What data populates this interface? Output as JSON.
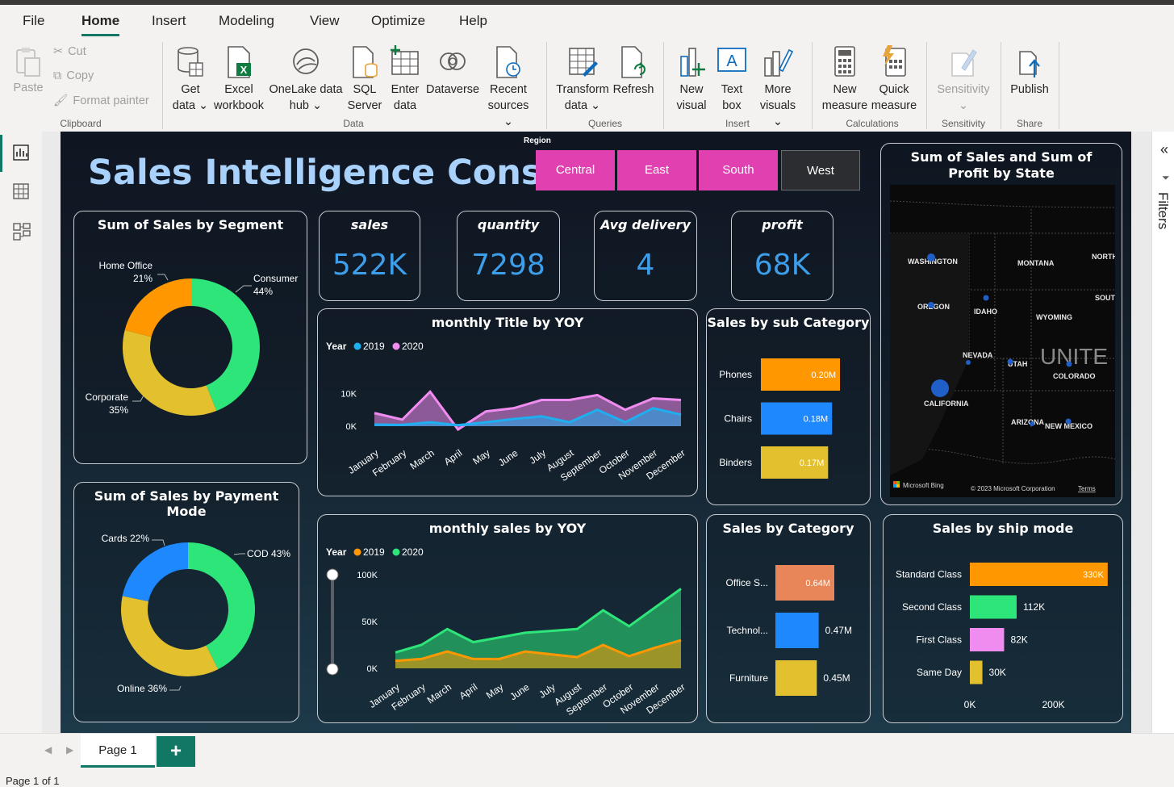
{
  "menu": {
    "file": "File",
    "home": "Home",
    "insert": "Insert",
    "modeling": "Modeling",
    "view": "View",
    "optimize": "Optimize",
    "help": "Help"
  },
  "ribbon": {
    "clipboard": {
      "paste": "Paste",
      "cut": "Cut",
      "copy": "Copy",
      "format_painter": "Format painter",
      "group": "Clipboard"
    },
    "data": {
      "get_data_1": "Get",
      "get_data_2": "data",
      "excel_1": "Excel",
      "excel_2": "workbook",
      "onelake_1": "OneLake data",
      "onelake_2": "hub",
      "sql_1": "SQL",
      "sql_2": "Server",
      "enter_1": "Enter",
      "enter_2": "data",
      "dataverse": "Dataverse",
      "recent_1": "Recent",
      "recent_2": "sources",
      "group": "Data"
    },
    "queries": {
      "transform_1": "Transform",
      "transform_2": "data",
      "refresh": "Refresh",
      "group": "Queries"
    },
    "insert": {
      "new_visual_1": "New",
      "new_visual_2": "visual",
      "text_box_1": "Text",
      "text_box_2": "box",
      "more_visuals_1": "More",
      "more_visuals_2": "visuals",
      "group": "Insert"
    },
    "calculations": {
      "new_measure_1": "New",
      "new_measure_2": "measure",
      "quick_measure_1": "Quick",
      "quick_measure_2": "measure",
      "group": "Calculations"
    },
    "sensitivity": {
      "label": "Sensitivity",
      "group": "Sensitivity"
    },
    "share": {
      "publish": "Publish",
      "group": "Share"
    }
  },
  "right_pane": {
    "filters": "Filters"
  },
  "report": {
    "title": "Sales Intelligence Console",
    "slicer": {
      "label": "Region",
      "items": [
        "Central",
        "East",
        "South",
        "West"
      ]
    },
    "kpis": [
      {
        "title": "sales",
        "value": "522K"
      },
      {
        "title": "quantity",
        "value": "7298"
      },
      {
        "title": "Avg delivery",
        "value": "4"
      },
      {
        "title": "profit",
        "value": "68K"
      }
    ],
    "segment_title": "Sum of Sales by Segment",
    "payment_title": "Sum of Sales by Payment Mode",
    "monthly_title_title": "monthly Title by YOY",
    "monthly_sales_title": "monthly sales by YOY",
    "subcat_title": "Sales by sub Category",
    "category_title": "Sales by Category",
    "map_title": "Sum of Sales and Sum of Profit by State",
    "ship_title": "Sales by ship mode",
    "map": {
      "states": [
        "WASHINGTON",
        "MONTANA",
        "NORTH",
        "OREGON",
        "IDAHO",
        "SOUTH",
        "WYOMING",
        "NEVADA",
        "UTAH",
        "UNITE",
        "COLORADO",
        "CALIFORNIA",
        "ARIZONA",
        "NEW MEXICO"
      ],
      "bing": "Microsoft Bing",
      "copyright": "© 2023 Microsoft Corporation",
      "terms": "Terms"
    }
  },
  "chart_data": [
    {
      "type": "pie",
      "title": "Sum of Sales by Segment",
      "labels": [
        "Consumer",
        "Corporate",
        "Home Office"
      ],
      "pct": [
        "44%",
        "35%",
        "21%"
      ],
      "values": [
        44,
        35,
        21
      ],
      "colors": [
        "#2ee57a",
        "#e3c02e",
        "#ff9800"
      ]
    },
    {
      "type": "pie",
      "title": "Sum of Sales by Payment Mode",
      "labels": [
        "COD",
        "Online",
        "Cards"
      ],
      "pct": [
        "43%",
        "36%",
        "22%"
      ],
      "values": [
        43,
        36,
        22
      ],
      "colors": [
        "#2ee57a",
        "#e3c02e",
        "#1e88ff"
      ]
    },
    {
      "type": "area",
      "title": "monthly Title by YOY",
      "legend_title": "Year",
      "categories": [
        "January",
        "February",
        "March",
        "April",
        "May",
        "June",
        "July",
        "August",
        "September",
        "October",
        "November",
        "December"
      ],
      "yticks": [
        "0K",
        "10K"
      ],
      "ylim": [
        0,
        16000
      ],
      "series": [
        {
          "name": "2019",
          "color": "#1eaff0",
          "values": [
            500,
            400,
            1200,
            300,
            1200,
            2200,
            3000,
            1200,
            5000,
            1200,
            5500,
            3500
          ]
        },
        {
          "name": "2020",
          "color": "#f08cf0",
          "values": [
            4000,
            2000,
            10500,
            -1000,
            4500,
            5500,
            8000,
            8000,
            9500,
            5000,
            8500,
            8000
          ]
        }
      ]
    },
    {
      "type": "area",
      "title": "monthly sales by YOY",
      "legend_title": "Year",
      "categories": [
        "January",
        "February",
        "March",
        "April",
        "May",
        "June",
        "July",
        "August",
        "September",
        "October",
        "November",
        "December"
      ],
      "yticks": [
        "0K",
        "50K",
        "100K"
      ],
      "ylim": [
        0,
        100000
      ],
      "series": [
        {
          "name": "2019",
          "color": "#ff9800",
          "values": [
            8000,
            10000,
            18000,
            10000,
            10000,
            18000,
            15000,
            12000,
            25000,
            13000,
            22000,
            30000
          ]
        },
        {
          "name": "2020",
          "color": "#2ee57a",
          "values": [
            17000,
            25000,
            42000,
            28000,
            33000,
            38000,
            40000,
            42000,
            62000,
            45000,
            65000,
            85000
          ]
        }
      ]
    },
    {
      "type": "bar",
      "title": "Sales by sub Category",
      "categories": [
        "Phones",
        "Chairs",
        "Binders"
      ],
      "values": [
        0.2,
        0.18,
        0.17
      ],
      "labels": [
        "0.20M",
        "0.18M",
        "0.17M"
      ],
      "colors": [
        "#ff9800",
        "#1e88ff",
        "#e3c02e"
      ]
    },
    {
      "type": "bar",
      "title": "Sales by Category",
      "categories": [
        "Office S...",
        "Technol...",
        "Furniture"
      ],
      "values": [
        0.64,
        0.47,
        0.45
      ],
      "labels": [
        "0.64M",
        "0.47M",
        "0.45M"
      ],
      "colors": [
        "#e8865a",
        "#1e88ff",
        "#e3c02e"
      ]
    },
    {
      "type": "bar",
      "title": "Sales by ship mode",
      "categories": [
        "Standard Class",
        "Second Class",
        "First Class",
        "Same Day"
      ],
      "values": [
        330,
        112,
        82,
        30
      ],
      "labels": [
        "330K",
        "112K",
        "82K",
        "30K"
      ],
      "xticks": [
        "0K",
        "200K"
      ],
      "xlim": [
        0,
        340
      ],
      "colors": [
        "#ff9800",
        "#2ee57a",
        "#f08cf0",
        "#e3c02e"
      ]
    }
  ],
  "tabs": {
    "page1": "Page 1",
    "add": "+"
  },
  "status": {
    "page": "Page 1 of 1"
  }
}
